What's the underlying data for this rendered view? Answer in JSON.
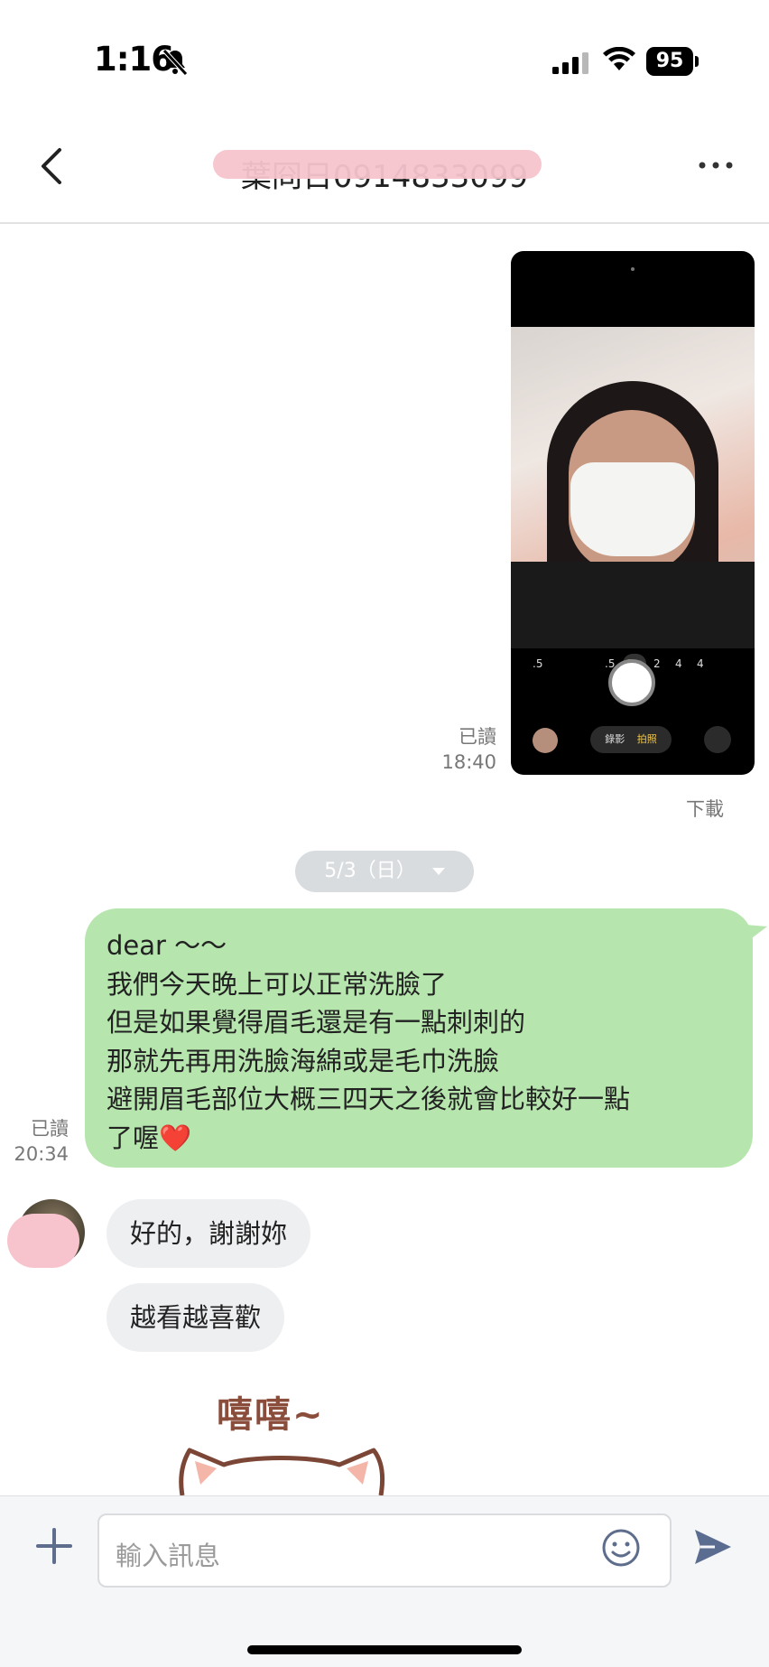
{
  "status_bar": {
    "time": "1:16",
    "battery": "95",
    "icons": [
      "bell-off-icon",
      "cellular-signal-icon",
      "wifi-icon",
      "battery-icon"
    ]
  },
  "header": {
    "title": "葉冏日0914833099",
    "icons": [
      "back-chevron-icon",
      "more-dots-icon"
    ]
  },
  "messages": {
    "photo": {
      "read_label": "已讀",
      "time": "18:40",
      "download_label": "下載",
      "camera_ui": {
        "zoom_labels": [
          ".5",
          ".5",
          "1×",
          "2",
          "4",
          "4"
        ],
        "mode_video": "錄影",
        "mode_photo": "拍照"
      }
    },
    "date_divider": "5/3（日）",
    "outgoing_text": {
      "lines": [
        "dear ～～",
        "我們今天晚上可以正常洗臉了",
        "但是如果覺得眉毛還是有一點刺刺的",
        "那就先再用洗臉海綿或是毛巾洗臉",
        "避開眉毛部位大概三四天之後就會比較好一點",
        "了喔"
      ],
      "emoji": "❤️",
      "read_label": "已讀",
      "time": "20:34"
    },
    "incoming": [
      {
        "text": "好的，謝謝妳"
      },
      {
        "text": "越看越喜歡"
      }
    ],
    "sticker": {
      "text": "嘻嘻~"
    }
  },
  "composer": {
    "placeholder": "輸入訊息",
    "icons": [
      "plus-icon",
      "emoji-icon",
      "send-icon"
    ]
  },
  "colors": {
    "outgoing_bubble": "#b6e6ad",
    "incoming_bubble": "#eeeff1",
    "date_pill": "#d9dcdf",
    "send_icon": "#5b6c91",
    "redaction": "#f7c4cd"
  }
}
